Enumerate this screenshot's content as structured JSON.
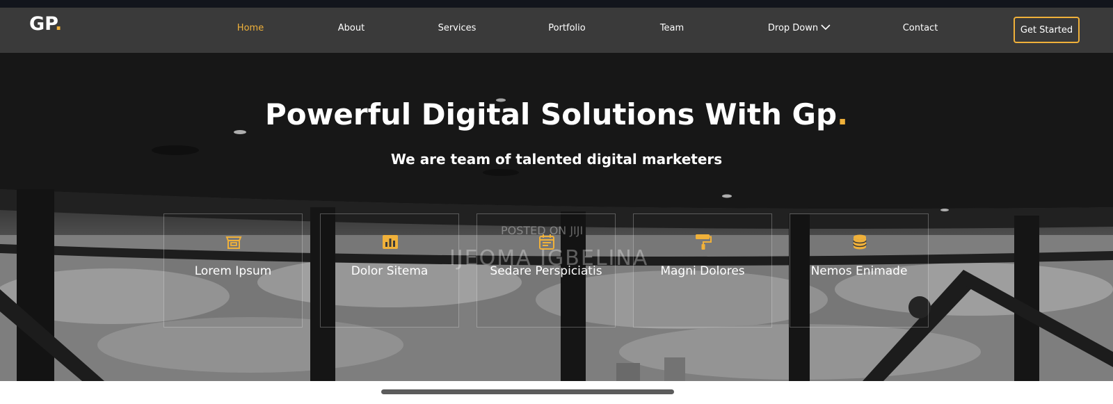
{
  "brand": {
    "logo_text": "GP",
    "logo_dot": ".",
    "accent_color": "#f0b13a"
  },
  "nav": {
    "items": [
      {
        "label": "Home",
        "active": true
      },
      {
        "label": "About"
      },
      {
        "label": "Services"
      },
      {
        "label": "Portfolio"
      },
      {
        "label": "Team"
      },
      {
        "label": "Drop Down",
        "icon": "chevron-down-icon"
      },
      {
        "label": "Contact"
      }
    ],
    "cta_label": "Get Started"
  },
  "hero": {
    "title": "Powerful Digital Solutions With Gp",
    "title_dot": ".",
    "subtitle": "We are team of talented digital marketers"
  },
  "features": [
    {
      "label": "Lorem Ipsum",
      "icon": "store-icon"
    },
    {
      "label": "Dolor Sitema",
      "icon": "bar-chart-icon"
    },
    {
      "label": "Sedare Perspiciatis",
      "icon": "calendar-icon"
    },
    {
      "label": "Magni Dolores",
      "icon": "paint-roller-icon"
    },
    {
      "label": "Nemos Enimade",
      "icon": "database-icon"
    }
  ],
  "watermark": {
    "line1": "POSTED ON JIJI",
    "line2": "IJEOMA IGBELINA"
  }
}
